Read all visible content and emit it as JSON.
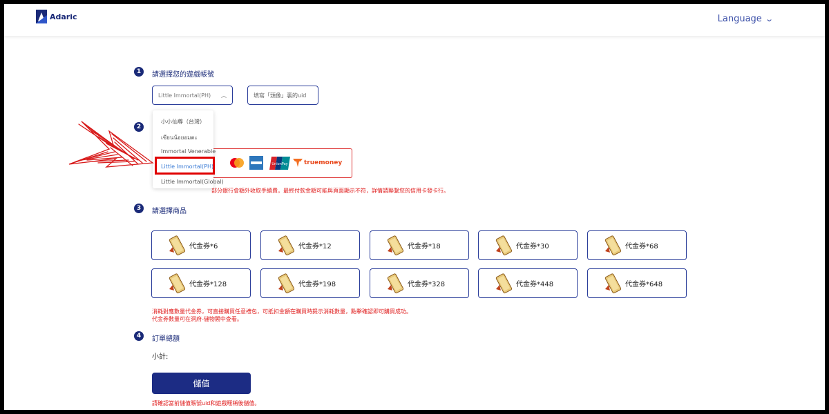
{
  "header": {
    "logo_text": "Adaric",
    "language_label": "Language"
  },
  "step1": {
    "number": "1",
    "title": "請選擇您的遊戲帳號",
    "selected_server": "Little Immortal(PH)",
    "uid_placeholder": "填寫「頭像」裏的uid"
  },
  "dropdown": {
    "items": [
      {
        "label": "小小仙尊（台灣）"
      },
      {
        "label": "เซียนน้อยอมตะ"
      },
      {
        "label": "Immortal Venerable"
      },
      {
        "label": "Little Immortal(PH)"
      },
      {
        "label": "Little Immortal(Global)"
      }
    ]
  },
  "step2": {
    "number": "2",
    "payment_methods": [
      "mastercard-icon",
      "amex-icon",
      "unionpay-icon",
      "truemoney-icon"
    ],
    "truemoney_label": "truemoney",
    "unionpay_label": "UnionPay",
    "note": "部分銀行會額外收取手續費，最終付款金額可能與頁面顯示不符，詳情請聯繫您的信用卡發卡行。"
  },
  "step3": {
    "number": "3",
    "title": "請選擇商品",
    "products": [
      {
        "label": "代金券*6"
      },
      {
        "label": "代金券*12"
      },
      {
        "label": "代金券*18"
      },
      {
        "label": "代金券*30"
      },
      {
        "label": "代金券*68"
      },
      {
        "label": "代金券*128"
      },
      {
        "label": "代金券*198"
      },
      {
        "label": "代金券*328"
      },
      {
        "label": "代金券*448"
      },
      {
        "label": "代金券*648"
      }
    ],
    "note_line1": "消耗對應數量代金券，可直接購買任意禮包，可抵扣金額在購買時提示消耗數量，點擊確認即可購買成功。",
    "note_line2": "代金券數量可在洞府-儲物閣中查看。"
  },
  "step4": {
    "number": "4",
    "title": "訂單總額",
    "subtotal_label": "小計:",
    "pay_button": "儲值",
    "note": "請確認當前儲值賬號uid和遊戲暱稱後儲值。"
  },
  "colors": {
    "brand": "#1a2a78",
    "button": "#1c2c84",
    "warning": "#e02020",
    "selected_item": "#3a7bd5",
    "highlight": "#e00000"
  }
}
